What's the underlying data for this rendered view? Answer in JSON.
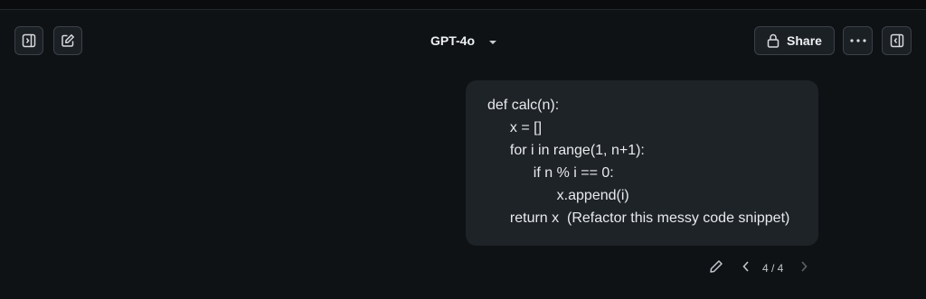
{
  "header": {
    "model_name": "GPT-4o",
    "share_label": "Share"
  },
  "message": {
    "code_lines": [
      "def calc(n):",
      "  x = []",
      "  for i in range(1, n+1):",
      "    if n % i == 0:",
      "      x.append(i)",
      "  return x  (Refactor this messy code snippet)"
    ],
    "pager": "4 / 4"
  },
  "icons": {
    "sidebar_left": "sidebar-toggle-icon",
    "new_chat": "edit-square-icon",
    "model_caret": "chevron-down-icon",
    "share": "lock-icon",
    "more": "ellipsis-icon",
    "sidebar_right": "sidebar-right-icon",
    "edit_message": "pencil-icon",
    "prev": "chevron-left-icon",
    "next": "chevron-right-icon"
  },
  "colors": {
    "background": "#0f1215",
    "bubble": "#1e2327",
    "button_border": "#3a4148",
    "text": "#e8eaec"
  }
}
